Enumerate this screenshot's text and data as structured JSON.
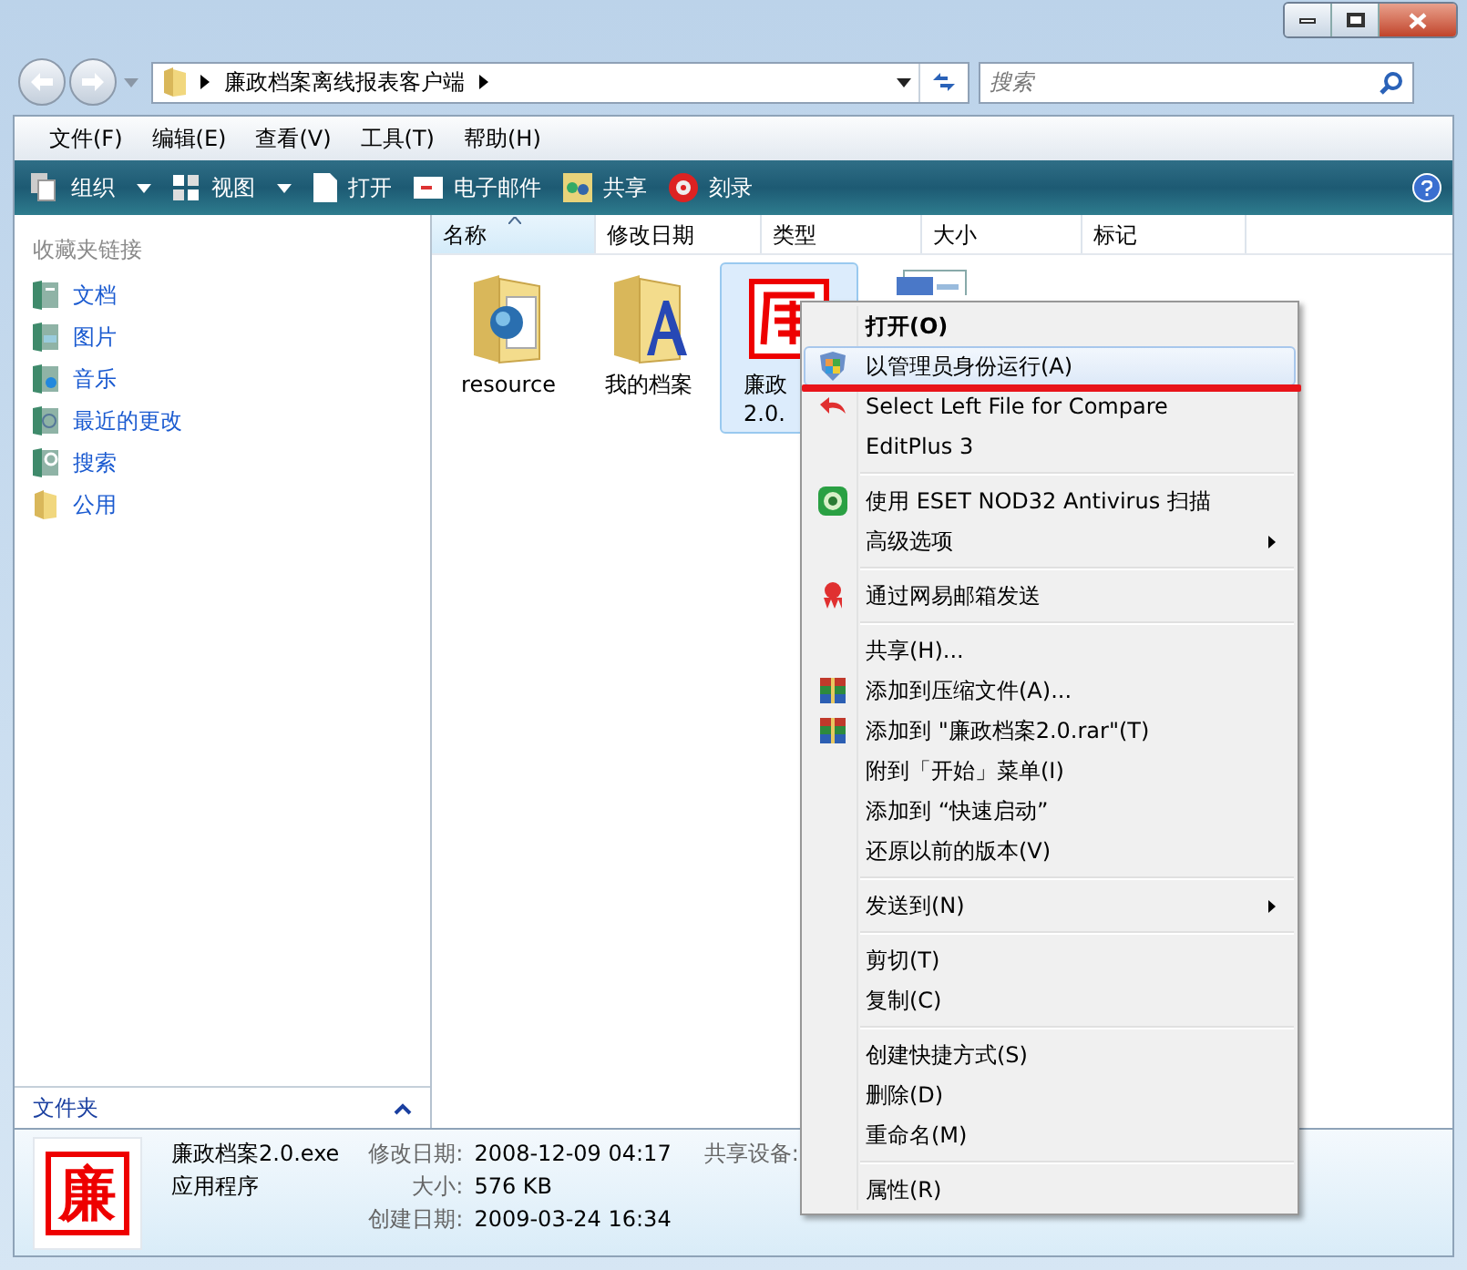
{
  "address": {
    "path": [
      "廉政档案离线报表客户端"
    ]
  },
  "search": {
    "placeholder": "搜索"
  },
  "menu_bar": [
    "文件(F)",
    "编辑(E)",
    "查看(V)",
    "工具(T)",
    "帮助(H)"
  ],
  "toolbar": [
    {
      "label": "组织",
      "kind": "organize",
      "dropdown": true
    },
    {
      "label": "视图",
      "kind": "views",
      "dropdown": true
    },
    {
      "label": "打开",
      "kind": "open",
      "dropdown": false
    },
    {
      "label": "电子邮件",
      "kind": "email",
      "dropdown": false
    },
    {
      "label": "共享",
      "kind": "share",
      "dropdown": false
    },
    {
      "label": "刻录",
      "kind": "burn",
      "dropdown": false
    }
  ],
  "sidebar": {
    "title": "收藏夹链接",
    "items": [
      {
        "label": "文档",
        "kind": "documents"
      },
      {
        "label": "图片",
        "kind": "pictures"
      },
      {
        "label": "音乐",
        "kind": "music"
      },
      {
        "label": "最近的更改",
        "kind": "recent"
      },
      {
        "label": "搜索",
        "kind": "search"
      },
      {
        "label": "公用",
        "kind": "public"
      }
    ],
    "folders_label": "文件夹"
  },
  "columns": [
    {
      "label": "名称",
      "sorted": true
    },
    {
      "label": "修改日期",
      "sorted": false
    },
    {
      "label": "类型",
      "sorted": false
    },
    {
      "label": "大小",
      "sorted": false
    },
    {
      "label": "标记",
      "sorted": false
    }
  ],
  "files": [
    {
      "kind": "folder-globe",
      "lines": [
        "resource"
      ],
      "selected": false
    },
    {
      "kind": "folder-font",
      "lines": [
        "我的档案"
      ],
      "selected": false
    },
    {
      "kind": "seal",
      "lines": [
        "廉政",
        "2.0."
      ],
      "selected": true
    },
    {
      "kind": "document",
      "selected": false
    }
  ],
  "context_menu": [
    {
      "kind": "plain",
      "label": "打开(O)",
      "default": true,
      "selected": false,
      "submenu": false,
      "underlined": false
    },
    {
      "kind": "shield",
      "label": "以管理员身份运行(A)",
      "default": false,
      "selected": true,
      "submenu": false,
      "underlined": true
    },
    {
      "kind": "undo",
      "label": "Select Left File for Compare",
      "default": false,
      "selected": false,
      "submenu": false,
      "underlined": false
    },
    {
      "kind": "plain",
      "label": "EditPlus 3",
      "default": false,
      "selected": false,
      "submenu": false,
      "underlined": false
    },
    {
      "kind": "separator"
    },
    {
      "kind": "eset",
      "label": "使用 ESET NOD32 Antivirus 扫描",
      "default": false,
      "selected": false,
      "submenu": false,
      "underlined": false
    },
    {
      "kind": "plain",
      "label": "高级选项",
      "default": false,
      "selected": false,
      "submenu": true,
      "underlined": false
    },
    {
      "kind": "separator"
    },
    {
      "kind": "mail",
      "label": "通过网易邮箱发送",
      "default": false,
      "selected": false,
      "submenu": false,
      "underlined": false
    },
    {
      "kind": "separator"
    },
    {
      "kind": "plain",
      "label": "共享(H)...",
      "default": false,
      "selected": false,
      "submenu": false,
      "underlined": false
    },
    {
      "kind": "archive",
      "label": "添加到压缩文件(A)...",
      "default": false,
      "selected": false,
      "submenu": false,
      "underlined": false
    },
    {
      "kind": "archive",
      "label": "添加到 \"廉政档案2.0.rar\"(T)",
      "default": false,
      "selected": false,
      "submenu": false,
      "underlined": false
    },
    {
      "kind": "plain",
      "label": "附到「开始」菜单(I)",
      "default": false,
      "selected": false,
      "submenu": false,
      "underlined": false
    },
    {
      "kind": "plain",
      "label": "添加到 “快速启动”",
      "default": false,
      "selected": false,
      "submenu": false,
      "underlined": false
    },
    {
      "kind": "plain",
      "label": "还原以前的版本(V)",
      "default": false,
      "selected": false,
      "submenu": false,
      "underlined": false
    },
    {
      "kind": "separator"
    },
    {
      "kind": "plain",
      "label": "发送到(N)",
      "default": false,
      "selected": false,
      "submenu": true,
      "underlined": false
    },
    {
      "kind": "separator"
    },
    {
      "kind": "plain",
      "label": "剪切(T)",
      "default": false,
      "selected": false,
      "submenu": false,
      "underlined": false
    },
    {
      "kind": "plain",
      "label": "复制(C)",
      "default": false,
      "selected": false,
      "submenu": false,
      "underlined": false
    },
    {
      "kind": "separator"
    },
    {
      "kind": "plain",
      "label": "创建快捷方式(S)",
      "default": false,
      "selected": false,
      "submenu": false,
      "underlined": false
    },
    {
      "kind": "plain",
      "label": "删除(D)",
      "default": false,
      "selected": false,
      "submenu": false,
      "underlined": false
    },
    {
      "kind": "plain",
      "label": "重命名(M)",
      "default": false,
      "selected": false,
      "submenu": false,
      "underlined": false
    },
    {
      "kind": "separator"
    },
    {
      "kind": "plain",
      "label": "属性(R)",
      "default": false,
      "selected": false,
      "submenu": false,
      "underlined": false
    }
  ],
  "details": {
    "glyph": "廉",
    "name": "廉政档案2.0.exe",
    "type": "应用程序",
    "fields": [
      {
        "label": "修改日期:",
        "value": "2008-12-09 04:17"
      },
      {
        "label": "大小:",
        "value": "576 KB"
      },
      {
        "label": "创建日期:",
        "value": "2009-03-24 16:34"
      }
    ],
    "extra_label": "共享设备:"
  }
}
